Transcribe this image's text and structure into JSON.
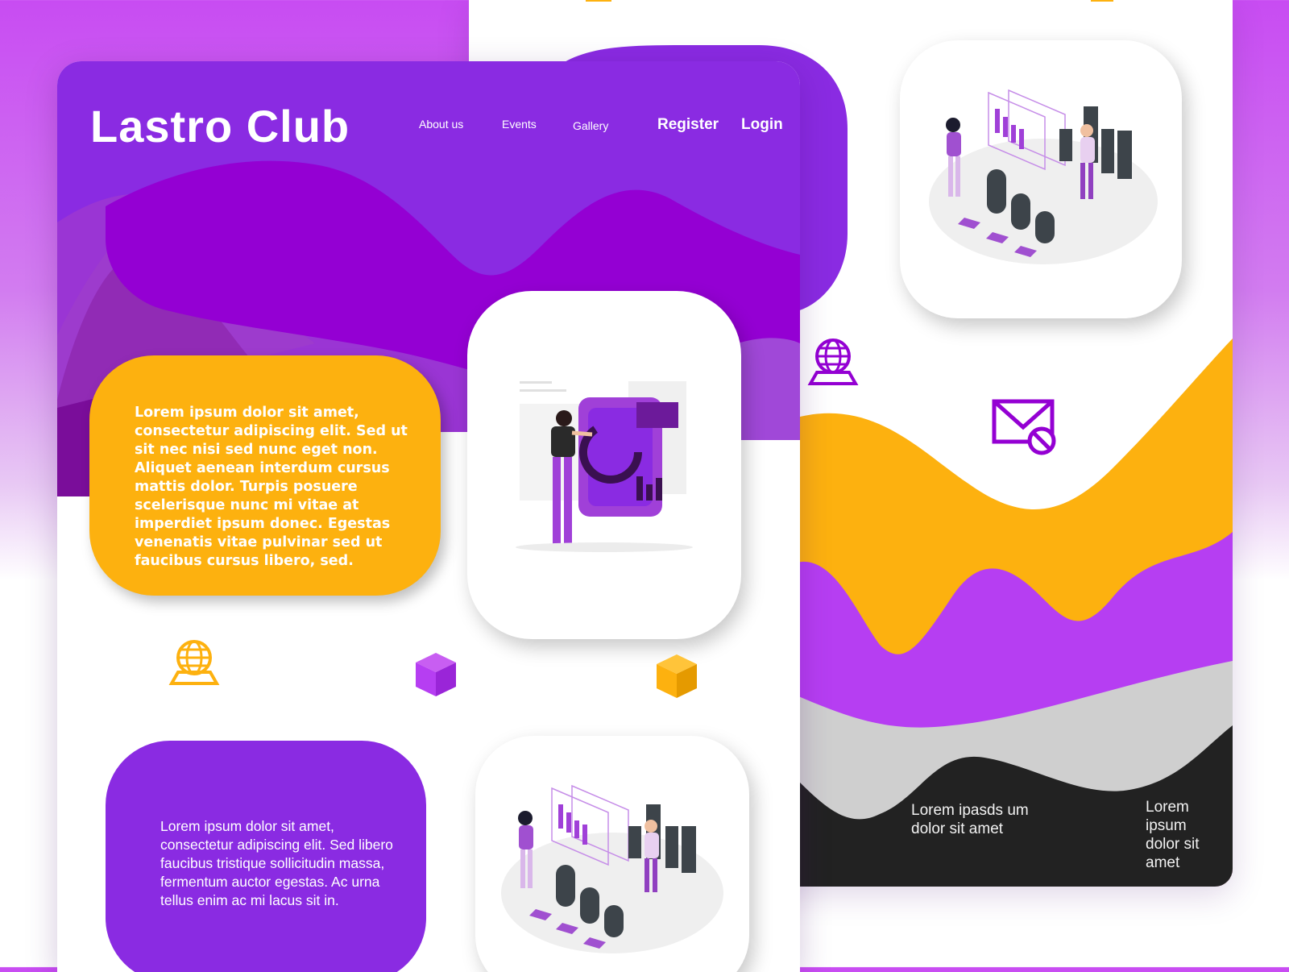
{
  "brand": {
    "title": "Lastro Club"
  },
  "nav": {
    "items": [
      "About us",
      "Events",
      "Gallery"
    ],
    "register": "Register",
    "login": "Login"
  },
  "sections": {
    "yellow_card_text": "Lorem ipsum dolor sit amet, consectetur adipiscing elit. Sed ut sit nec nisi sed nunc eget non. Aliquet aenean interdum cursus mattis dolor. Turpis posuere scelerisque nunc mi vitae at imperdiet ipsum donec. Egestas venenatis vitae pulvinar sed ut faucibus cursus libero, sed.",
    "purple_card_text": "Lorem ipsum dolor sit amet, consectetur adipiscing elit. Sed libero faucibus tristique sollicitudin massa, fermentum auctor egestas. Ac urna tellus enim ac mi lacus sit in."
  },
  "right_page": {
    "footer_text_1": "Lorem ipasds um dolor sit amet",
    "footer_text_2": "Lorem ipsum dolor sit amet"
  },
  "icons": {
    "left_row": [
      "globe-icon",
      "cube-icon",
      "cube-icon"
    ],
    "right_page": [
      "globe-icon",
      "mail-blocked-icon"
    ]
  },
  "colors": {
    "purple": "#8a2be2",
    "violet": "#9400d3",
    "magenta": "#b63ef2",
    "yellow": "#fdb10f",
    "dark": "#222222",
    "grey": "#cfcfcf"
  }
}
